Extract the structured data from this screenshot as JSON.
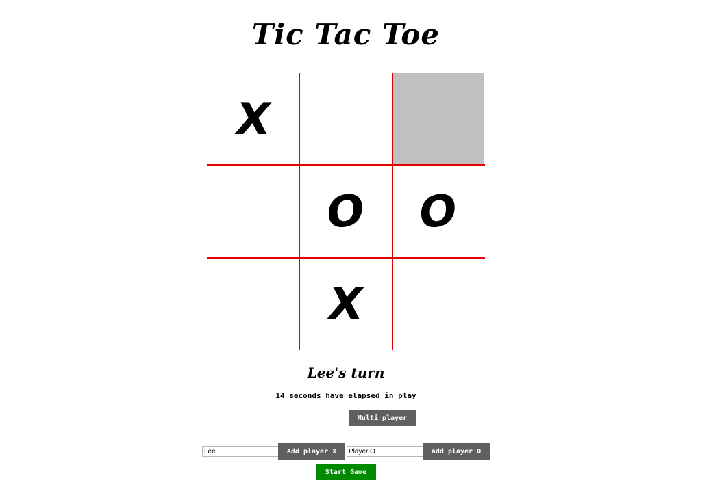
{
  "title": "Tic Tac Toe",
  "board": {
    "cells": [
      "X",
      "",
      "",
      "",
      "O",
      "O",
      "",
      "X",
      ""
    ],
    "highlighted_cell": 2,
    "line_color": "#e00000",
    "highlight_color": "#c0c0c0"
  },
  "status": {
    "turn": "Lee's turn",
    "elapsed": "14 seconds have elapsed in play"
  },
  "controls": {
    "multi_player": "Multi player",
    "player_x_value": "Lee",
    "add_player_x": "Add player X",
    "player_o_value": "Player O",
    "add_player_o": "Add player O",
    "start_game": "Start Game"
  },
  "colors": {
    "button_gray": "#5f5f5f",
    "button_green": "#008a00"
  }
}
